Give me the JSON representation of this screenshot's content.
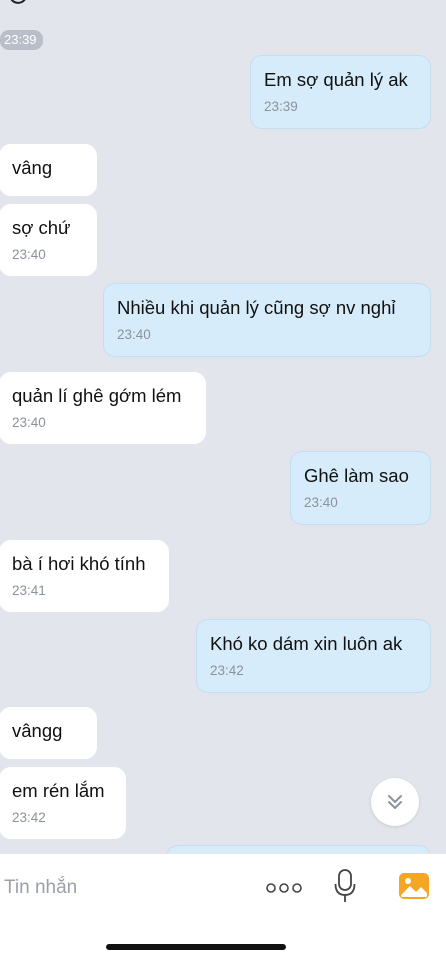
{
  "chat": {
    "top_timestamp": "23:39",
    "messages": [
      {
        "side": "out",
        "text": "Em sợ quản lý ak",
        "time": "23:39"
      },
      {
        "side": "in",
        "text": "vâng",
        "time": ""
      },
      {
        "side": "in",
        "text": "sợ chứ",
        "time": "23:40"
      },
      {
        "side": "out",
        "text": "Nhiều khi quản lý cũng sợ nv nghỉ",
        "time": "23:40"
      },
      {
        "side": "in",
        "text": "quản lí ghê gớm lém",
        "time": "23:40"
      },
      {
        "side": "out",
        "text": "Ghê làm sao",
        "time": "23:40"
      },
      {
        "side": "in",
        "text": "bà í hơi khó tính",
        "time": "23:41"
      },
      {
        "side": "out",
        "text": "Khó ko dám xin luôn ak",
        "time": "23:42"
      },
      {
        "side": "in",
        "text": "vângg",
        "time": ""
      },
      {
        "side": "in",
        "text": "em rén lắm",
        "time": "23:42"
      }
    ]
  },
  "input_bar": {
    "placeholder": "Tin nhắn"
  },
  "icons": {
    "scroll_down": "double-chevron-down-icon",
    "more": "more-dots-icon",
    "mic": "microphone-icon",
    "image": "image-gallery-icon"
  },
  "colors": {
    "background": "#e2e5ec",
    "incoming_bubble": "#ffffff",
    "outgoing_bubble": "#d6ecfb",
    "timestamp": "#8c929b",
    "image_icon": "#f5a623"
  }
}
